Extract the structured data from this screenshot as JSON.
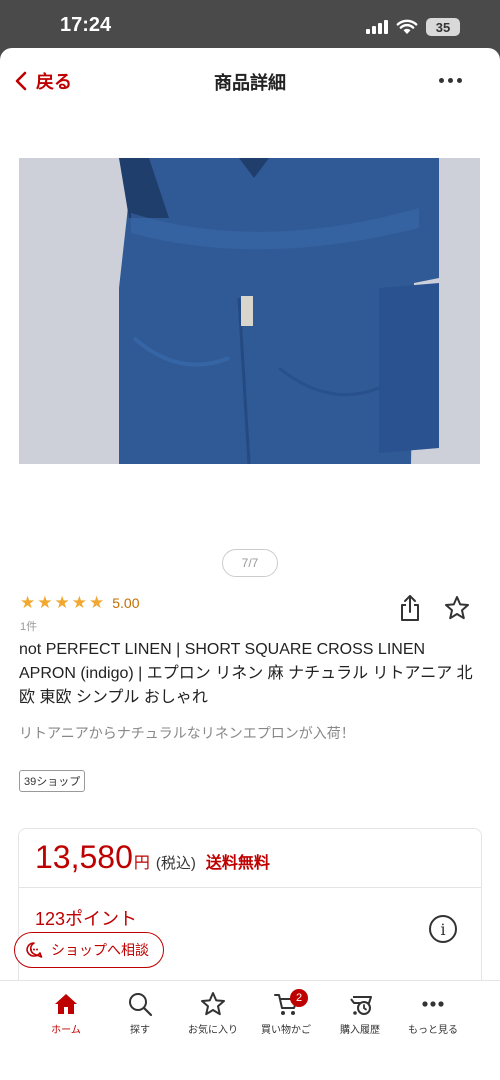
{
  "status_bar": {
    "time": "17:24",
    "battery": "35"
  },
  "nav": {
    "back_label": "戻る",
    "title": "商品詳細"
  },
  "gallery": {
    "pager": "7/7"
  },
  "product": {
    "rating_score": "5.00",
    "review_count": "1件",
    "name": "not PERFECT LINEN | SHORT SQUARE CROSS LINEN APRON (indigo) | エプロン リネン 麻 ナチュラル リトアニア 北欧 東欧 シンプル おしゃれ",
    "catch_copy": "リトアニアからナチュラルなリネンエプロンが入荷！",
    "shop_badge": "39ショップ"
  },
  "price": {
    "amount": "13,580",
    "currency": "円",
    "tax": "(税込)",
    "shipping": "送料無料",
    "points": "123ポイント"
  },
  "consult_button": "ショップへ相談",
  "tabbar": {
    "cart_badge": "2",
    "items": [
      {
        "label": "ホーム",
        "icon": "home-icon"
      },
      {
        "label": "探す",
        "icon": "search-icon"
      },
      {
        "label": "お気に入り",
        "icon": "star-icon"
      },
      {
        "label": "買い物かご",
        "icon": "cart-icon"
      },
      {
        "label": "購入履歴",
        "icon": "history-icon"
      },
      {
        "label": "もっと見る",
        "icon": "more-icon"
      }
    ]
  },
  "colors": {
    "accent": "#bf0000",
    "star": "#f0a830",
    "apron": "#2f5a96"
  }
}
